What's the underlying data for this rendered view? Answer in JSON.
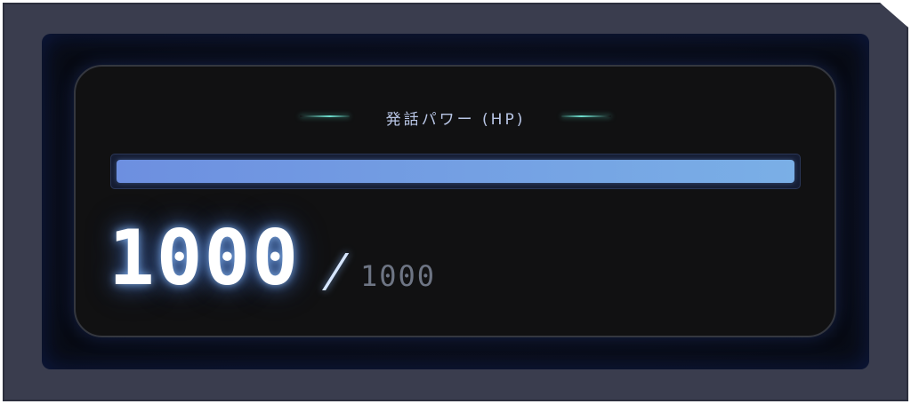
{
  "hp_panel": {
    "label": "発話パワー (HP)",
    "current": "1000",
    "separator": "/",
    "max": "1000",
    "fill_fraction": 1.0,
    "colors": {
      "bar_start": "#6d8fe0",
      "bar_end": "#7aafe6",
      "accent_line": "#6fe0cf",
      "current_text": "#ffffff",
      "max_text": "#6e7584"
    }
  }
}
